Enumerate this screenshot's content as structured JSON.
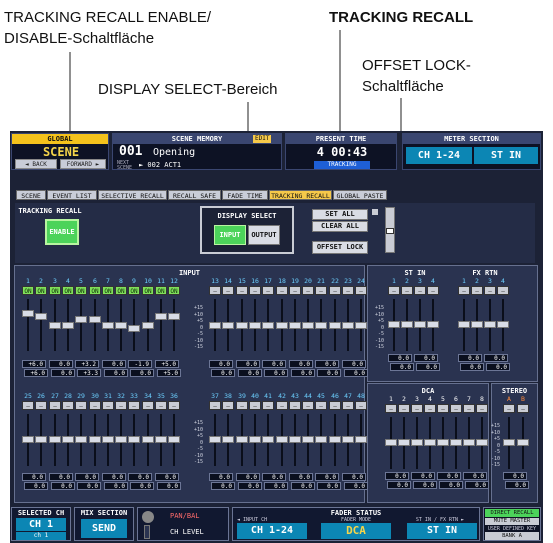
{
  "callouts": {
    "tracking_enable_line1": "TRACKING RECALL ENABLE/",
    "tracking_enable_line2": "DISABLE-Schaltfläche",
    "tracking_recall": "TRACKING RECALL",
    "offset_lock_line1": "OFFSET LOCK-",
    "offset_lock_line2": "Schaltfläche",
    "display_select": "DISPLAY SELECT-Bereich"
  },
  "header": {
    "global_label": "GLOBAL",
    "scene_label": "SCENE",
    "back_label": "◄ BACK",
    "forward_label": "FORWARD ►",
    "scene_memory_label": "SCENE MEMORY",
    "edit_badge": "EDIT",
    "scene_number": "001",
    "scene_name": "Opening",
    "next_label": "NEXT SCENE",
    "next_scene": "► 002 ACT1",
    "present_time_label": "PRESENT TIME",
    "present_time": "4 00:43",
    "tracking_badge": "TRACKING",
    "meter_section_label": "METER SECTION",
    "meter_ch": "CH 1-24",
    "meter_st": "ST IN"
  },
  "tabs": [
    "SCENE",
    "EVENT LIST",
    "SELECTIVE RECALL",
    "RECALL SAFE",
    "FADE TIME",
    "TRACKING RECALL",
    "GLOBAL PASTE"
  ],
  "tracking": {
    "title": "TRACKING RECALL",
    "enable_label": "ENABLE",
    "display_select_title": "DISPLAY SELECT",
    "input_label": "INPUT",
    "output_label": "OUTPUT",
    "set_all_label": "SET ALL",
    "clear_all_label": "CLEAR ALL",
    "offset_lock_label": "OFFSET LOCK"
  },
  "input": {
    "title": "INPUT",
    "row1_channels": [
      "1",
      "2",
      "3",
      "4",
      "5",
      "6",
      "7",
      "8",
      "9",
      "10",
      "11",
      "12",
      "13",
      "14",
      "15",
      "16",
      "17",
      "18",
      "19",
      "20",
      "21",
      "22",
      "23",
      "24"
    ],
    "row1_switches": [
      "ON",
      "ON",
      "ON",
      "ON",
      "ON",
      "ON",
      "ON",
      "ON",
      "ON",
      "ON",
      "ON",
      "ON",
      "—",
      "—",
      "—",
      "—",
      "—",
      "—",
      "—",
      "—",
      "—",
      "—",
      "—",
      "—"
    ],
    "row1_switch_on": [
      true,
      true,
      true,
      true,
      true,
      true,
      true,
      true,
      true,
      true,
      true,
      true,
      false,
      false,
      false,
      false,
      false,
      false,
      false,
      false,
      false,
      false,
      false,
      false
    ],
    "row1_values": [
      "+6.0",
      "+6.0",
      "0.0",
      "0.0",
      "+3.2",
      "+3.3",
      "0.0",
      "0.0",
      "-1.9",
      "0.0",
      "+5.0",
      "+5.0",
      "0.0",
      "0.0",
      "0.0",
      "0.0",
      "0.0",
      "0.0",
      "0.0",
      "0.0",
      "0.0",
      "0.0",
      "0.0",
      "0.0"
    ],
    "row1_levels": [
      0.75,
      0.7,
      0.5,
      0.5,
      0.62,
      0.62,
      0.5,
      0.5,
      0.42,
      0.5,
      0.68,
      0.68,
      0.5,
      0.5,
      0.5,
      0.5,
      0.5,
      0.5,
      0.5,
      0.5,
      0.5,
      0.5,
      0.5,
      0.5
    ],
    "row2_channels": [
      "25",
      "26",
      "27",
      "28",
      "29",
      "30",
      "31",
      "32",
      "33",
      "34",
      "35",
      "36",
      "37",
      "38",
      "39",
      "40",
      "41",
      "42",
      "43",
      "44",
      "45",
      "46",
      "47",
      "48"
    ],
    "row2_values": [
      "0.0",
      "0.0",
      "0.0",
      "0.0",
      "0.0",
      "0.0",
      "0.0",
      "0.0",
      "0.0",
      "0.0",
      "0.0",
      "0.0",
      "0.0",
      "0.0",
      "0.0",
      "0.0",
      "0.0",
      "0.0",
      "0.0",
      "0.0",
      "0.0",
      "0.0",
      "0.0",
      "0.0"
    ]
  },
  "scale_marks": [
    "+15",
    "+10",
    "+5",
    "0",
    "-5",
    "-10",
    "-15"
  ],
  "st_in": {
    "title": "ST IN",
    "channels": [
      "1",
      "2",
      "3",
      "4"
    ],
    "values": [
      "0.0",
      "0.0",
      "0.0",
      "0.0"
    ]
  },
  "fx_rtn": {
    "title": "FX RTN",
    "channels": [
      "1",
      "2",
      "3",
      "4"
    ],
    "values": [
      "0.0",
      "0.0",
      "0.0",
      "0.0"
    ]
  },
  "dca": {
    "title": "DCA",
    "channels": [
      "1",
      "2",
      "3",
      "4",
      "5",
      "6",
      "7",
      "8"
    ],
    "values": [
      "0.0",
      "0.0",
      "0.0",
      "0.0",
      "0.0",
      "0.0",
      "0.0",
      "0.0"
    ]
  },
  "stereo": {
    "title": "STEREO",
    "channels": [
      "A",
      "B"
    ],
    "values": [
      "0.0",
      "0.0"
    ]
  },
  "footer": {
    "selected_ch_label": "SELECTED CH",
    "selected_ch": "CH 1",
    "selected_sub": "ch 1",
    "mix_section_label": "MIX SECTION",
    "mix_value": "SEND",
    "pan_bal": "PAN/BAL",
    "ch_level": "CH LEVEL",
    "fader_status_label": "FADER STATUS",
    "input_ch_label": "◄ INPUT CH",
    "fader_ch": "CH 1-24",
    "fader_mode_label": "FADER MODE",
    "fader_mode": "DCA",
    "stin_fx_label": "ST IN / FX RTN ►",
    "fader_stin": "ST IN",
    "direct_recall": "DIRECT RECALL",
    "mute_master": "MUTE MASTER",
    "user_defined": "USER DEFINED KEY",
    "bank": "BANK A"
  },
  "colors": {
    "screen_bg": "#1c2236",
    "accent_green": "#4cd35a",
    "header_cyan": "#1ec3e6",
    "tab_active": "#f6c94a",
    "value_yellow": "#f5d54a"
  }
}
